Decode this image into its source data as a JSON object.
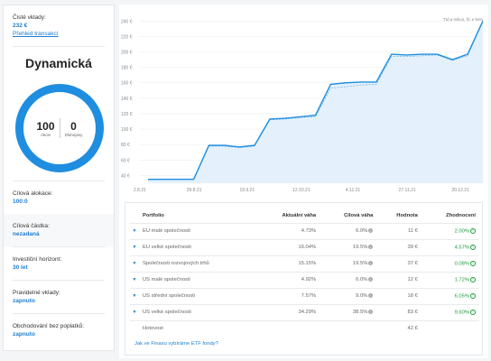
{
  "left": {
    "clean_deposits_label": "Čisté vklady:",
    "clean_deposits_value": "232 €",
    "transactions_link": "Přehled transakcí",
    "strategy_title": "Dynamická",
    "donut": {
      "stocks_value": "100",
      "stocks_label": "Akcie",
      "bonds_value": "0",
      "bonds_label": "Dluhopisy"
    },
    "target_allocation_label": "Cílová alokace:",
    "target_allocation_value": "100:0",
    "target_amount_label": "Cílová částka:",
    "target_amount_value": "nezadaná",
    "horizon_label": "Investiční horizont:",
    "horizon_value": "30 let",
    "regular_deposits_label": "Pravidelné vklady:",
    "regular_deposits_value": "zapnuto",
    "fee_free_label": "Obchodování bez poplatků:",
    "fee_free_value": "zapnuto"
  },
  "chart_data": {
    "type": "area",
    "legend_text": "Ttd a milion, f/c e belo",
    "y_ticks": [
      "40 €",
      "60 €",
      "80 €",
      "100 €",
      "120 €",
      "140 €",
      "160 €",
      "180 €",
      "200 €",
      "220 €",
      "240 €"
    ],
    "x_ticks": [
      "2.8.21",
      "29.8.21",
      "19.9.21",
      "12.10.21",
      "4.11.21",
      "27.11.21",
      "20.12.21"
    ],
    "ylim": [
      30,
      245
    ],
    "series": [
      {
        "values": [
          35,
          35,
          35,
          35,
          79,
          79,
          77,
          79,
          113,
          114,
          116,
          118,
          158,
          160,
          161,
          161,
          197,
          196,
          197,
          197,
          190,
          197,
          240
        ]
      },
      {
        "values": [
          35,
          35,
          35,
          35,
          78,
          78,
          76,
          78,
          112,
          113,
          115,
          116,
          153,
          155,
          157,
          158,
          194,
          194,
          195,
          196,
          189,
          195,
          240
        ]
      }
    ],
    "color": "#1f8ee0"
  },
  "table": {
    "headers": [
      "Portfolio",
      "Aktuální váha",
      "Cílová váha",
      "Hodnota",
      "Zhodnocení"
    ],
    "rows": [
      {
        "name": "EU malé společnosti",
        "current": "4.73%",
        "target": "6.0%",
        "value": "11 €",
        "gain": "2.00%"
      },
      {
        "name": "EU velké společnosti",
        "current": "16.04%",
        "target": "19.5%",
        "value": "39 €",
        "gain": "4.57%"
      },
      {
        "name": "Společnosti rozvojových trhů",
        "current": "15.15%",
        "target": "19.5%",
        "value": "37 €",
        "gain": "0.08%"
      },
      {
        "name": "US malé společnosti",
        "current": "4.92%",
        "target": "6.0%",
        "value": "12 €",
        "gain": "1.72%"
      },
      {
        "name": "US střední společnosti",
        "current": "7.57%",
        "target": "9.0%",
        "value": "18 €",
        "gain": "6.05%"
      },
      {
        "name": "US velké společnosti",
        "current": "34.29%",
        "target": "38.5%",
        "value": "83 €",
        "gain": "9.60%"
      }
    ],
    "cash_label": "Hotovost",
    "cash_value": "42 €",
    "faq_link": "Jak ve Finaxu vybíráme ETF fondy?"
  }
}
